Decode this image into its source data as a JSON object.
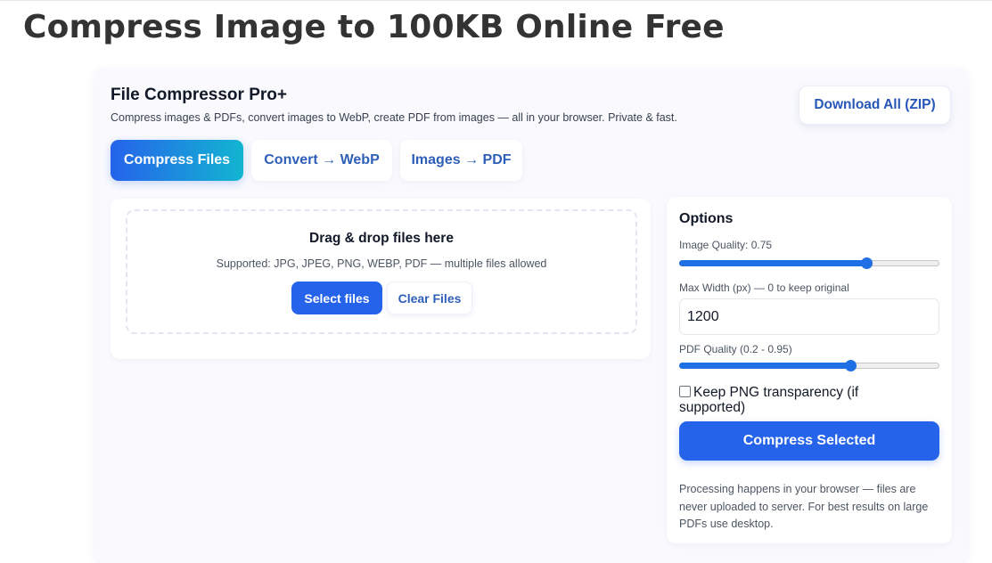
{
  "page": {
    "title": "Compress Image to 100KB Online Free"
  },
  "app": {
    "title": "File Compressor Pro+",
    "subtitle": "Compress images & PDFs, convert images to WebP, create PDF from images — all in your browser. Private & fast.",
    "download_all_label": "Download All (ZIP)"
  },
  "tabs": [
    {
      "label": "Compress Files",
      "active": true
    },
    {
      "label": "Convert → WebP",
      "active": false
    },
    {
      "label": "Images → PDF",
      "active": false
    }
  ],
  "dropzone": {
    "title": "Drag & drop files here",
    "supported": "Supported: JPG, JPEG, PNG, WEBP, PDF — multiple files allowed",
    "select_label": "Select files",
    "clear_label": "Clear Files"
  },
  "options": {
    "title": "Options",
    "image_quality_label": "Image Quality: 0.75",
    "image_quality_value": 0.75,
    "max_width_label": "Max Width (px) — 0 to keep original",
    "max_width_value": "1200",
    "pdf_quality_label": "PDF Quality (0.2 - 0.95)",
    "pdf_quality_value": 0.66,
    "keep_png_label": "Keep PNG transparency (if supported)",
    "keep_png_checked": false,
    "compress_label": "Compress Selected",
    "note": "Processing happens in your browser — files are never uploaded to server. For best results on large PDFs use desktop."
  },
  "colors": {
    "accent": "#2563eb",
    "accent_gradient_end": "#12b5d1",
    "link_text": "#2e5fb8"
  }
}
